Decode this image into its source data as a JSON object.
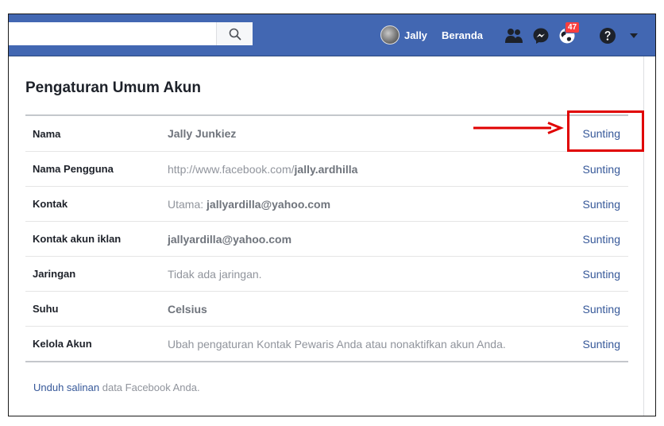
{
  "topbar": {
    "search": {
      "value": "",
      "placeholder": ""
    },
    "user_name": "Jally",
    "home_label": "Beranda",
    "notifications_count": "47"
  },
  "settings": {
    "title": "Pengaturan Umum Akun",
    "edit_label": "Sunting",
    "rows": [
      {
        "label": "Nama",
        "value_bold": "Jally Junkiez"
      },
      {
        "label": "Nama Pengguna",
        "value_prefix": "http://www.facebook.com/",
        "value_bold": "jally.ardhilla"
      },
      {
        "label": "Kontak",
        "value_prefix": "Utama: ",
        "value_bold": "jallyardilla@yahoo.com"
      },
      {
        "label": "Kontak akun iklan",
        "value_bold": "jallyardilla@yahoo.com"
      },
      {
        "label": "Jaringan",
        "value": "Tidak ada jaringan."
      },
      {
        "label": "Suhu",
        "value_bold": "Celsius"
      },
      {
        "label": "Kelola Akun",
        "value": "Ubah pengaturan Kontak Pewaris Anda atau nonaktifkan akun Anda."
      }
    ],
    "footer": {
      "link_text": "Unduh salinan",
      "rest": " data Facebook Anda."
    }
  },
  "colors": {
    "topbar": "#4267b2",
    "link": "#365899",
    "muted_text": "#90949c",
    "badge": "#fa3e3e",
    "annotation": "#e00000"
  },
  "icons": {
    "search": "search-icon",
    "friends": "friend-requests-icon",
    "messenger": "messenger-icon",
    "notifications": "notifications-globe-icon",
    "help": "help-icon",
    "menu": "caret-down-icon"
  }
}
